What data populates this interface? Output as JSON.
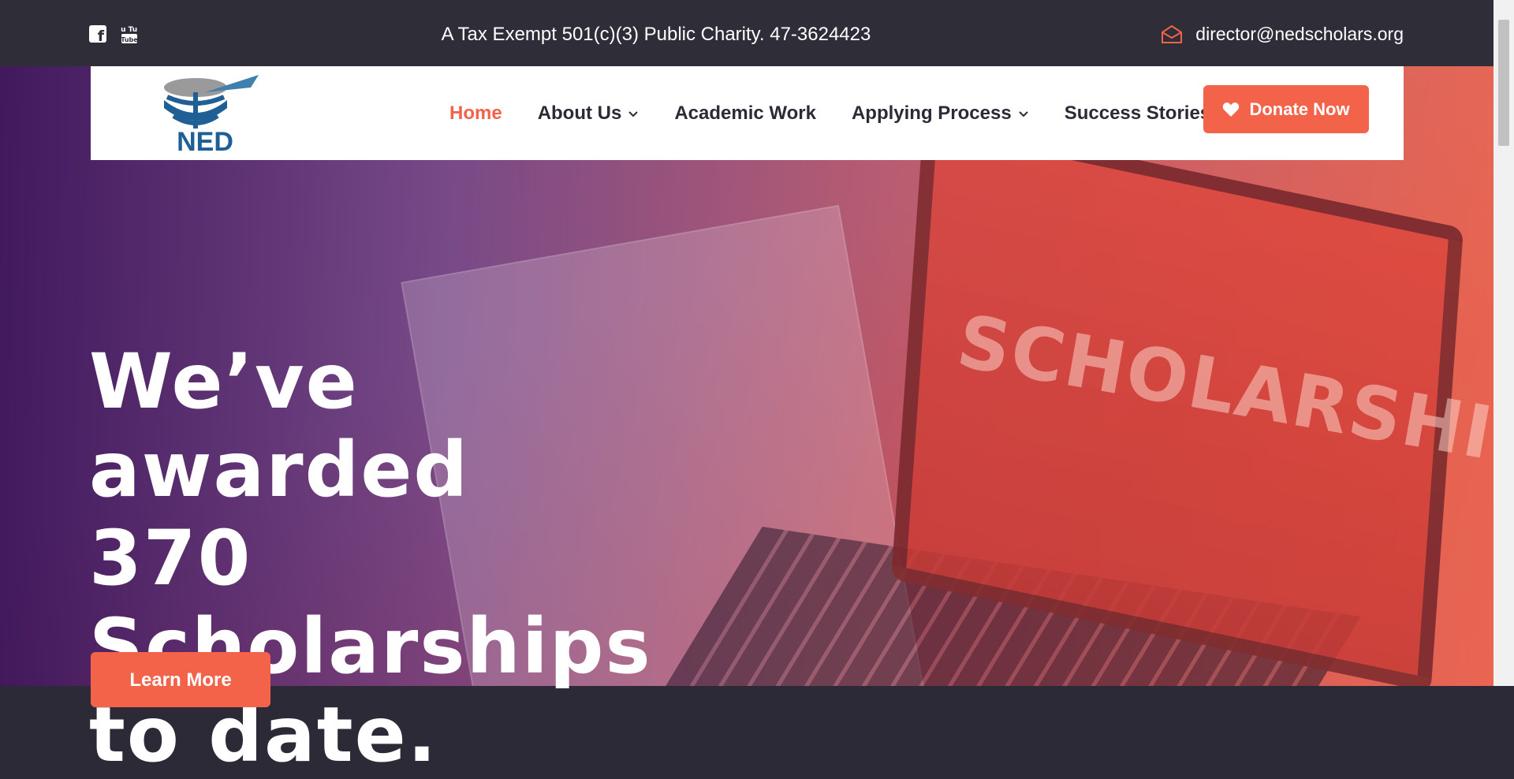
{
  "topbar": {
    "social": [
      {
        "icon": "facebook-icon",
        "label": "Facebook"
      },
      {
        "icon": "youtube-icon",
        "label": "YouTube",
        "text": "You Tube"
      }
    ],
    "charity_text": "A Tax Exempt 501(c)(3) Public Charity. 47-3624423",
    "email": "director@nedscholars.org",
    "email_icon": "envelope-icon"
  },
  "logo": {
    "text": "NED",
    "icon": "globe-arrow-logo"
  },
  "nav": {
    "items": [
      {
        "label": "Home",
        "active": true,
        "dropdown": false
      },
      {
        "label": "About Us",
        "active": false,
        "dropdown": true
      },
      {
        "label": "Academic Work",
        "active": false,
        "dropdown": false
      },
      {
        "label": "Applying Process",
        "active": false,
        "dropdown": true
      },
      {
        "label": "Success Stories",
        "active": false,
        "dropdown": false
      }
    ],
    "donate_label": "Donate Now",
    "donate_icon": "heart-icon"
  },
  "hero": {
    "headline": "We’ve awarded\n370 Scholarships\nto date.",
    "background_text": "SCHOLARSHIP",
    "cta_label": "Learn More"
  },
  "colors": {
    "accent": "#f2634a",
    "topbar": "#2e2d38",
    "text_dark": "#2b2a36",
    "logo_blue": "#1f5f96"
  }
}
